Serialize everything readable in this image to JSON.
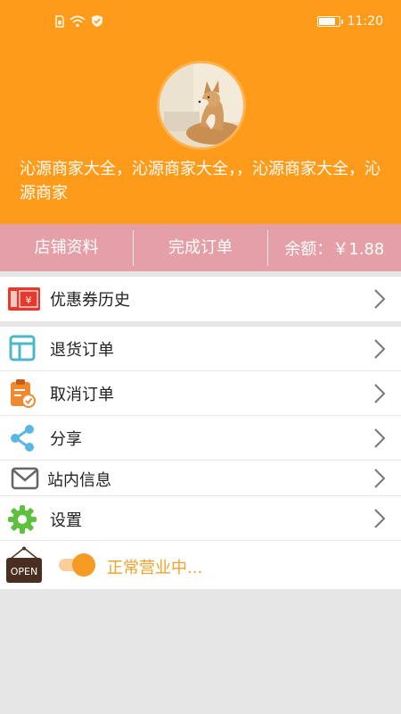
{
  "status_bar": {
    "time": "11:20",
    "battery_level": 0.8,
    "icons": [
      "sim-icon",
      "wifi-icon",
      "shield-check-icon",
      "battery-icon"
    ]
  },
  "profile": {
    "avatar": "dog-photo-avatar",
    "description": "沁源商家大全，沁源商家大全，，沁源商家大全，沁源商家"
  },
  "stats_bar": {
    "shop_info_label": "店铺资料",
    "completed_orders_label": "完成订单",
    "balance_label": "余额：￥1.88"
  },
  "menu": {
    "items": [
      {
        "label": "优惠券历史",
        "icon": "coupon-icon"
      },
      {
        "label": "退货订单",
        "icon": "return-orders-icon"
      },
      {
        "label": "取消订单",
        "icon": "cancel-orders-icon"
      },
      {
        "label": "分享",
        "icon": "share-icon"
      },
      {
        "label": "站内信息",
        "icon": "mail-icon"
      },
      {
        "label": "设置",
        "icon": "gear-icon"
      }
    ]
  },
  "business_status": {
    "sign_text": "OPEN",
    "toggle_on": true,
    "label": "正常营业中..."
  },
  "colors": {
    "header": "#ff9b1a",
    "stats_bar": "#e59fa6",
    "accent": "#f59a23"
  }
}
